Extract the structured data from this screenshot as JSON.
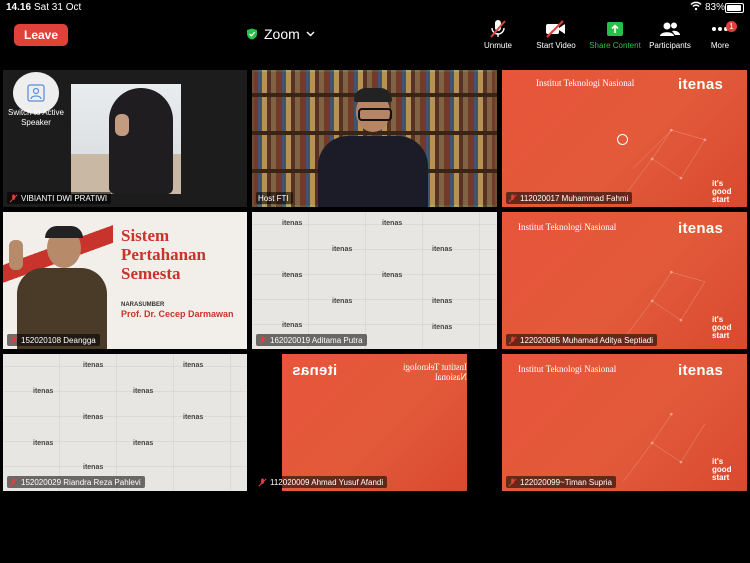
{
  "status": {
    "time": "14.16",
    "date": "Sat 31 Oct",
    "battery": "83%",
    "battery_level": 0.83
  },
  "toolbar": {
    "leave_label": "Leave",
    "app_title": "Zoom",
    "buttons": [
      {
        "label": "Unmute",
        "icon": "mic-muted-icon"
      },
      {
        "label": "Start Video",
        "icon": "video-off-icon"
      },
      {
        "label": "Share Content",
        "icon": "share-icon"
      },
      {
        "label": "Participants",
        "icon": "participants-icon"
      },
      {
        "label": "More",
        "icon": "more-icon",
        "badge": "1"
      }
    ]
  },
  "switch_label": "Switch to Active Speaker",
  "tiles": [
    {
      "name": "VIBIANTI DWI PRATIWI"
    },
    {
      "name": "Host FTI"
    },
    {
      "name": "112020017 Muhammad Fahmi"
    },
    {
      "name": "152020108 Deangga"
    },
    {
      "name": "162020019 Aditama Putra"
    },
    {
      "name": "122020085 Muhamad Aditya Septiadi"
    },
    {
      "name": "152020029 Riandra Reza Pahlevi"
    },
    {
      "name": "112020009 Ahmad Yusuf Afandi"
    },
    {
      "name": "122020099~Timan Supria"
    }
  ],
  "branding": {
    "itenas": "itenas",
    "institut": "Institut Teknologi Nasional",
    "institut_mirrored": "Institut Teknologi Nasional",
    "its_good_start": "it's good start"
  },
  "poster": {
    "title_line1": "Sistem",
    "title_line2": "Pertahanan",
    "title_line3": "Semesta",
    "narasumber": "NARASUMBER",
    "speaker": "Prof. Dr. Cecep Darmawan"
  },
  "colors": {
    "leave": "#e0413a",
    "active_border": "#33c15a",
    "share_green": "#27c14a",
    "itenas_orange": "#e25a3a"
  }
}
